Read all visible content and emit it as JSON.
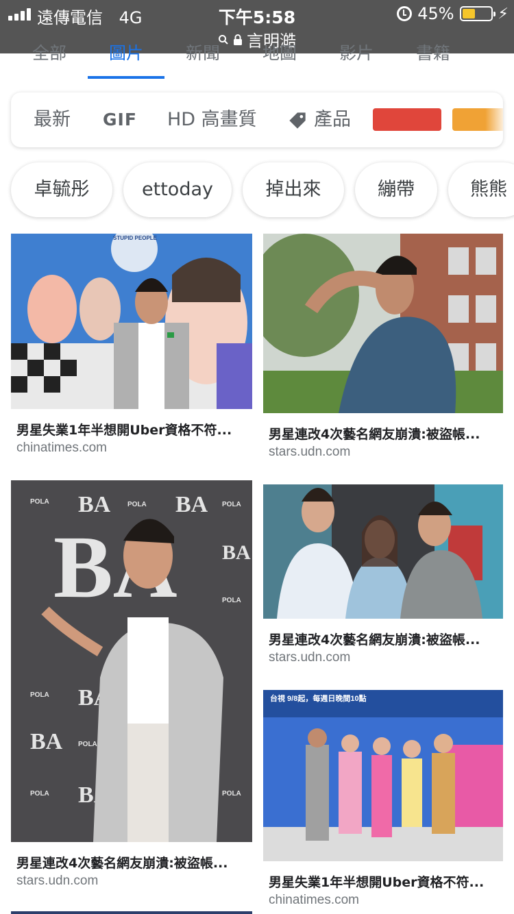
{
  "status_bar": {
    "carrier": "遠傳電信",
    "network": "4G",
    "time": "下午5:58",
    "battery_percent": "45%",
    "battery_level": 0.45,
    "url_text": "言明澔"
  },
  "tabs": {
    "items": [
      {
        "label": "全部"
      },
      {
        "label": "圖片"
      },
      {
        "label": "新聞"
      },
      {
        "label": "地圖"
      },
      {
        "label": "影片"
      },
      {
        "label": "書籍"
      }
    ],
    "active_index": 1
  },
  "filters": {
    "items": [
      {
        "label": "最新"
      },
      {
        "label": "GIF"
      },
      {
        "label": "HD 高畫質"
      },
      {
        "label": "產品"
      }
    ],
    "color_swatches": [
      "#e0463b",
      "#f0a235"
    ]
  },
  "chips": [
    {
      "label": "卓毓彤"
    },
    {
      "label": "ettoday"
    },
    {
      "label": "掉出來"
    },
    {
      "label": "繃帶"
    },
    {
      "label": "熊熊"
    }
  ],
  "results": [
    {
      "title": "男星失業1年半想開Uber資格不符...",
      "source": "chinatimes.com",
      "thumb_text": "STUPID PEOPLE"
    },
    {
      "title": "男星連改4次藝名網友崩潰:被盜帳...",
      "source": "stars.udn.com"
    },
    {
      "title": "男星連改4次藝名網友崩潰:被盜帳...",
      "source": "stars.udn.com",
      "thumb_text": "POLA",
      "thumb_logo": "BA"
    },
    {
      "title": "男星連改4次藝名網友崩潰:被盜帳...",
      "source": "stars.udn.com"
    },
    {
      "title": "男星失業1年半想開Uber資格不符...",
      "source": "chinatimes.com",
      "thumb_text": "台視 9/8起，每週日晚間10點"
    }
  ],
  "colors": {
    "status_bar_bg": "#555555",
    "accent_blue": "#1a73e8",
    "battery_yellow": "#f6c62b"
  }
}
